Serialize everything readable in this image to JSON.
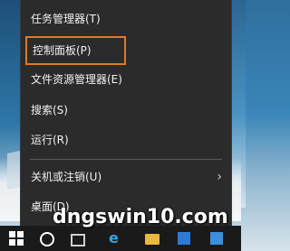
{
  "context_menu": {
    "items": [
      {
        "label": "任务管理器(T)"
      },
      {
        "label": "控制面板(P)"
      },
      {
        "label": "文件资源管理器(E)"
      },
      {
        "label": "搜索(S)"
      },
      {
        "label": "运行(R)"
      },
      {
        "label": "关机或注销(U)"
      },
      {
        "label": "桌面(D)"
      }
    ],
    "submenu_chevron": "›",
    "highlight_color": "#e07a1f",
    "background_color": "#2b2b2b"
  },
  "watermark": {
    "text": "dngswin10.com"
  },
  "taskbar": {
    "icons": [
      "windows-start-icon",
      "search-circle-icon",
      "task-view-icon",
      "edge-browser-icon",
      "file-explorer-icon",
      "store-icon",
      "app-icon"
    ]
  }
}
